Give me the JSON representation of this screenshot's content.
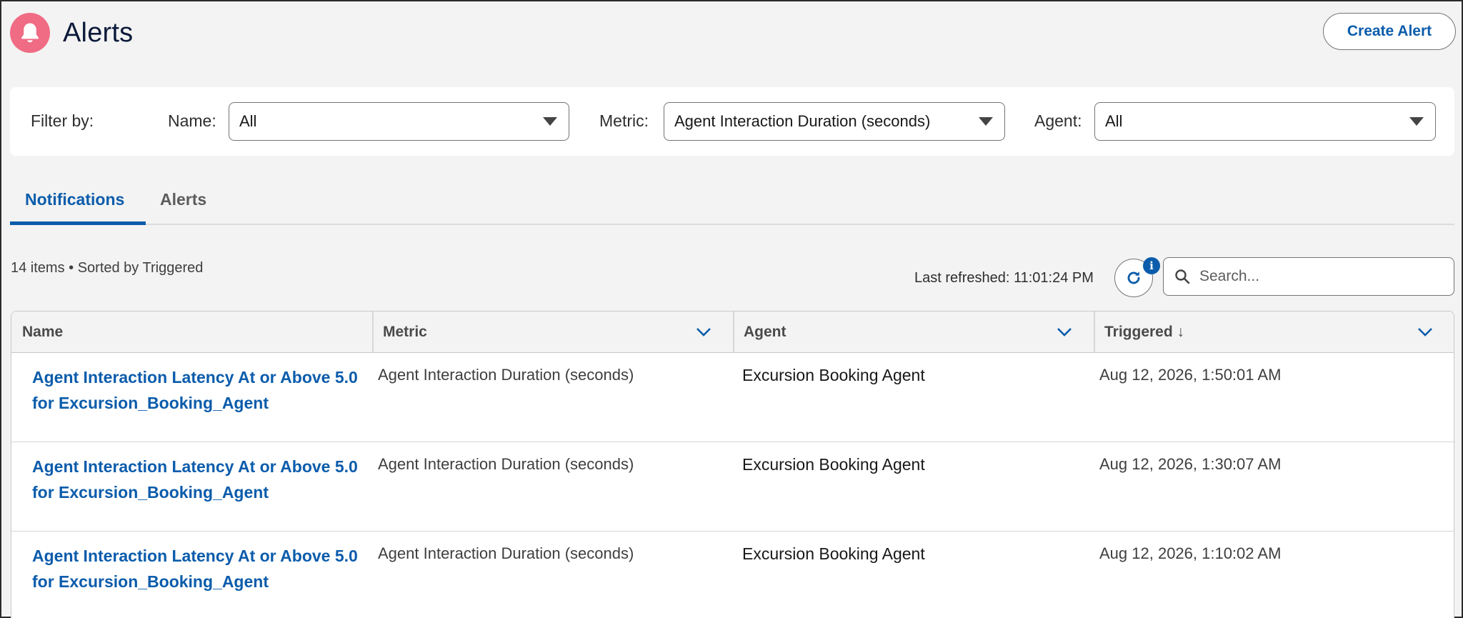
{
  "header": {
    "title": "Alerts",
    "create_label": "Create Alert"
  },
  "filters": {
    "filter_by_label": "Filter by:",
    "name_label": "Name:",
    "name_value": "All",
    "metric_label": "Metric:",
    "metric_value": "Agent Interaction Duration (seconds)",
    "agent_label": "Agent:",
    "agent_value": "All"
  },
  "tabs": [
    {
      "label": "Notifications",
      "active": true
    },
    {
      "label": "Alerts",
      "active": false
    }
  ],
  "list_meta": {
    "summary": "14 items • Sorted by Triggered",
    "last_refreshed": "Last refreshed: 11:01:24 PM",
    "info_glyph": "i",
    "search_placeholder": "Search..."
  },
  "table": {
    "columns": [
      "Name",
      "Metric",
      "Agent",
      "Triggered ↓"
    ],
    "rows": [
      {
        "name": "Agent Interaction Latency At or Above 5.0 for Excursion_Booking_Agent",
        "metric": "Agent Interaction Duration (seconds)",
        "agent": "Excursion Booking Agent",
        "triggered": "Aug 12, 2026, 1:50:01 AM"
      },
      {
        "name": "Agent Interaction Latency At or Above 5.0 for Excursion_Booking_Agent",
        "metric": "Agent Interaction Duration (seconds)",
        "agent": "Excursion Booking Agent",
        "triggered": "Aug 12, 2026, 1:30:07 AM"
      },
      {
        "name": "Agent Interaction Latency At or Above 5.0 for Excursion_Booking_Agent",
        "metric": "Agent Interaction Duration (seconds)",
        "agent": "Excursion Booking Agent",
        "triggered": "Aug 12, 2026, 1:10:02 AM"
      }
    ]
  },
  "colors": {
    "brand_blue": "#0b5cab",
    "alert_icon_bg": "#f06b84",
    "page_bg": "#f3f3f3"
  },
  "icons": [
    "bell-icon",
    "caret-down-icon",
    "chevron-down-icon",
    "refresh-icon",
    "info-icon",
    "search-icon"
  ]
}
